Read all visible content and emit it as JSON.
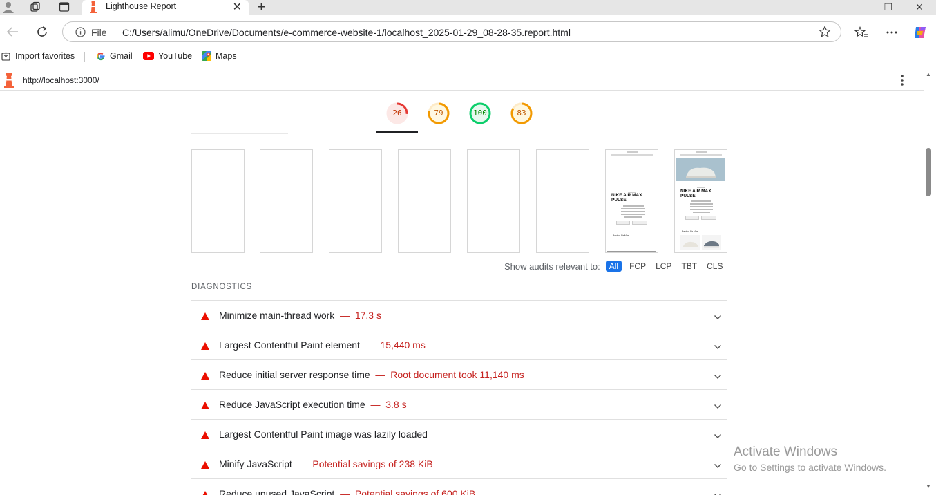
{
  "browser": {
    "tab_title": "Lighthouse Report",
    "address_scheme": "File",
    "address_url": "C:/Users/alimu/OneDrive/Documents/e-commerce-website-1/localhost_2025-01-29_08-28-35.report.html"
  },
  "bookmarks": [
    {
      "label": "Import favorites",
      "icon": "import-icon"
    },
    {
      "label": "Gmail",
      "icon": "google-icon"
    },
    {
      "label": "YouTube",
      "icon": "youtube-icon"
    },
    {
      "label": "Maps",
      "icon": "maps-icon"
    }
  ],
  "report": {
    "page_url": "http://localhost:3000/",
    "scores": [
      {
        "value": "26",
        "color": "#e53935",
        "fraction": 0.26
      },
      {
        "value": "79",
        "color": "#f29900",
        "fraction": 0.79
      },
      {
        "value": "100",
        "color": "#0cce6b",
        "fraction": 1.0
      },
      {
        "value": "83",
        "color": "#f29900",
        "fraction": 0.83
      }
    ],
    "filmstrip": {
      "frame_heading_1": "NIKE AIR MAX",
      "frame_heading_2": "PULSE",
      "frame_section": "Best of Air Max"
    },
    "filter": {
      "label": "Show audits relevant to:",
      "options": [
        "All",
        "FCP",
        "LCP",
        "TBT",
        "CLS"
      ],
      "active": "All"
    },
    "diagnostics_heading": "DIAGNOSTICS",
    "audits": [
      {
        "title": "Minimize main-thread work",
        "display": "17.3 s"
      },
      {
        "title": "Largest Contentful Paint element",
        "display": "15,440 ms"
      },
      {
        "title": "Reduce initial server response time",
        "display": "Root document took 11,140 ms"
      },
      {
        "title": "Reduce JavaScript execution time",
        "display": "3.8 s"
      },
      {
        "title": "Largest Contentful Paint image was lazily loaded",
        "display": ""
      },
      {
        "title": "Minify JavaScript",
        "display": "Potential savings of 238 KiB"
      },
      {
        "title": "Reduce unused JavaScript",
        "display": "Potential savings of 600 KiB"
      }
    ]
  },
  "watermark": {
    "line1": "Activate Windows",
    "line2": "Go to Settings to activate Windows."
  },
  "colors": {
    "fail_red": "#c5221f",
    "fail_icon": "#eb0f00",
    "accent_blue": "#1a73e8"
  }
}
